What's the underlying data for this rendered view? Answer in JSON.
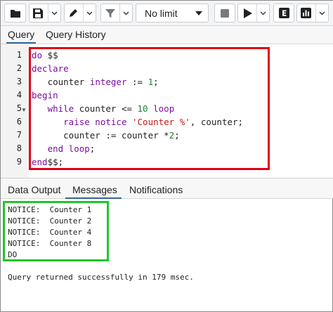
{
  "toolbar": {
    "limit_label": "No limit",
    "icons": [
      "folder-icon",
      "save-icon",
      "pen-icon",
      "filter-icon",
      "stop-icon",
      "play-icon",
      "explain-icon",
      "chart-icon"
    ]
  },
  "query_tabs": [
    {
      "label": "Query",
      "active": true
    },
    {
      "label": "Query History",
      "active": false
    }
  ],
  "editor": {
    "line_numbers": [
      "1",
      "2",
      "3",
      "4",
      "5",
      "6",
      "7",
      "8",
      "9"
    ],
    "lines": {
      "l1_kw": "do",
      "l1_rest": " $$",
      "l2_kw": "declare",
      "l3_a": "   counter ",
      "l3_kw": "integer",
      "l3_b": " := ",
      "l3_num": "1",
      "l3_c": ";",
      "l4_kw": "begin",
      "l5_a": "   ",
      "l5_kw": "while",
      "l5_b": " counter <= ",
      "l5_num": "10",
      "l5_c": " ",
      "l5_kw2": "loop",
      "l6_a": "      ",
      "l6_kw": "raise notice",
      "l6_b": " ",
      "l6_str": "'Counter %'",
      "l6_c": ", counter;",
      "l7_a": "      counter := counter *",
      "l7_num": "2",
      "l7_c": ";",
      "l8_a": "   ",
      "l8_kw": "end loop",
      "l8_b": ";",
      "l9_kw": "end",
      "l9_rest": "$$;"
    }
  },
  "output_tabs": [
    {
      "label": "Data Output",
      "active": false
    },
    {
      "label": "Messages",
      "active": true
    },
    {
      "label": "Notifications",
      "active": false
    }
  ],
  "messages": {
    "lines": [
      "NOTICE:  Counter 1",
      "NOTICE:  Counter 2",
      "NOTICE:  Counter 4",
      "NOTICE:  Counter 8",
      "DO"
    ],
    "status": "Query returned successfully in 179 msec."
  },
  "colors": {
    "highlight_red": "#e2001a",
    "highlight_green": "#22c52a",
    "active_tab": "#326690",
    "keyword": "#7a0d9b"
  }
}
